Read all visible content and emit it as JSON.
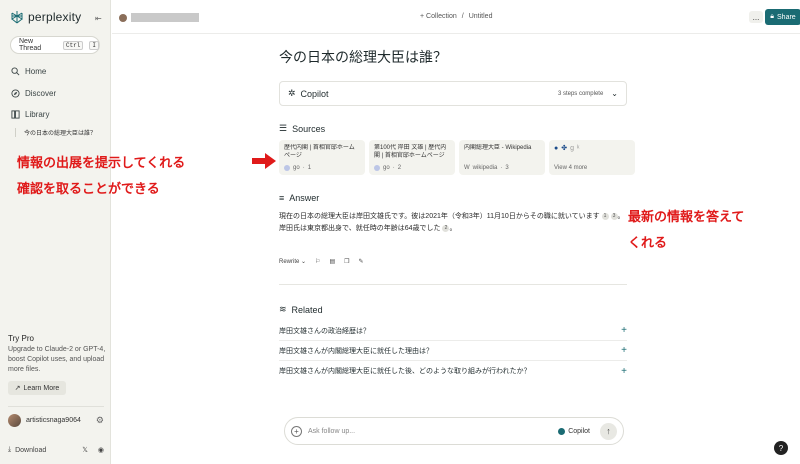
{
  "brand": {
    "name": "perplexity"
  },
  "sidebar": {
    "new_thread": "New Thread",
    "kbd1": "Ctrl",
    "kbd2": "I",
    "items": [
      {
        "label": "Home"
      },
      {
        "label": "Discover"
      },
      {
        "label": "Library"
      }
    ],
    "library_thread": "今の日本の総理大臣は誰？",
    "try_pro": {
      "title": "Try Pro",
      "body": "Upgrade to Claude-2 or GPT-4, boost Copilot uses, and upload more files.",
      "button": "Learn More"
    },
    "user": "artisticsnaga9064",
    "download": "Download"
  },
  "header": {
    "collection": "+ Collection",
    "sep": "/",
    "title": "Untitled",
    "more": "...",
    "share": "Share"
  },
  "thread": {
    "question": "今の日本の総理大臣は誰？",
    "copilot": {
      "title": "Copilot",
      "status": "3 steps complete"
    },
    "sources_title": "Sources",
    "sources": [
      {
        "title": "歴代内閣 | 首相官邸ホームページ",
        "site": "go",
        "num": "1"
      },
      {
        "title": "第100代 岸田 文雄 | 歴代内閣 | 首相官邸ホームページ",
        "site": "go",
        "num": "2"
      },
      {
        "title": "内閣総理大臣 - Wikipedia",
        "site": "wikipedia",
        "num": "3"
      }
    ],
    "view_more": "View 4 more",
    "answer_title": "Answer",
    "answer_line1": "現在の日本の総理大臣は岸田文雄氏です。彼は2021年（令和3年）11月10日からその職に就いています",
    "answer_cite1": "1",
    "answer_cite2": "3",
    "answer_line2": "。岸田氏は東京都出身で、就任時の年齢は64歳でした",
    "answer_cite3": "2",
    "answer_line2_end": "。",
    "rewrite": "Rewrite",
    "related_title": "Related",
    "related": [
      {
        "label": "岸田文雄さんの政治経歴は？"
      },
      {
        "label": "岸田文雄さんが内閣総理大臣に就任した理由は？"
      },
      {
        "label": "岸田文雄さんが内閣総理大臣に就任した後、どのような取り組みが行われたか？"
      }
    ],
    "followup_placeholder": "Ask follow up...",
    "copilot_toggle": "Copilot"
  },
  "annotations": {
    "left_line1": "情報の出展を提示してくれる",
    "left_line2": "確認を取ることができる",
    "right_line1": "最新の情報を答えて",
    "right_line2": "くれる"
  },
  "help": "?",
  "colors": {
    "accent": "#1a6b73",
    "annotation": "#e01a1a",
    "sidebar_bg": "#f3f3ee"
  }
}
